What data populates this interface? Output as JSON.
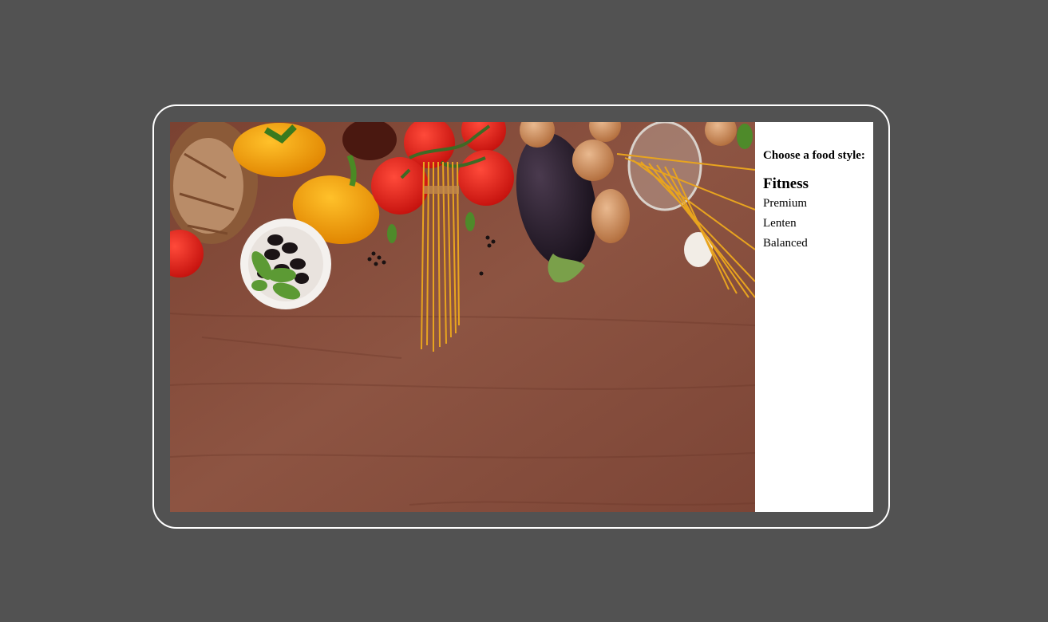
{
  "hero_image": {
    "icon": "kitchen-table-ingredients-photo",
    "items": [
      "bread",
      "yellow-bell-pepper",
      "olives-bowl",
      "tomatoes",
      "spaghetti",
      "eggplant",
      "onions",
      "pasta-jar",
      "basil"
    ]
  },
  "food_style_panel": {
    "prompt": "Choose a food style:",
    "options": [
      {
        "label": "Fitness",
        "selected": true
      },
      {
        "label": "Premium",
        "selected": false
      },
      {
        "label": "Lenten",
        "selected": false
      },
      {
        "label": "Balanced",
        "selected": false
      }
    ]
  },
  "colors": {
    "background": "#525252",
    "frame": "#ffffff",
    "panel": "#ffffff",
    "wood": "#8a4e3c"
  }
}
